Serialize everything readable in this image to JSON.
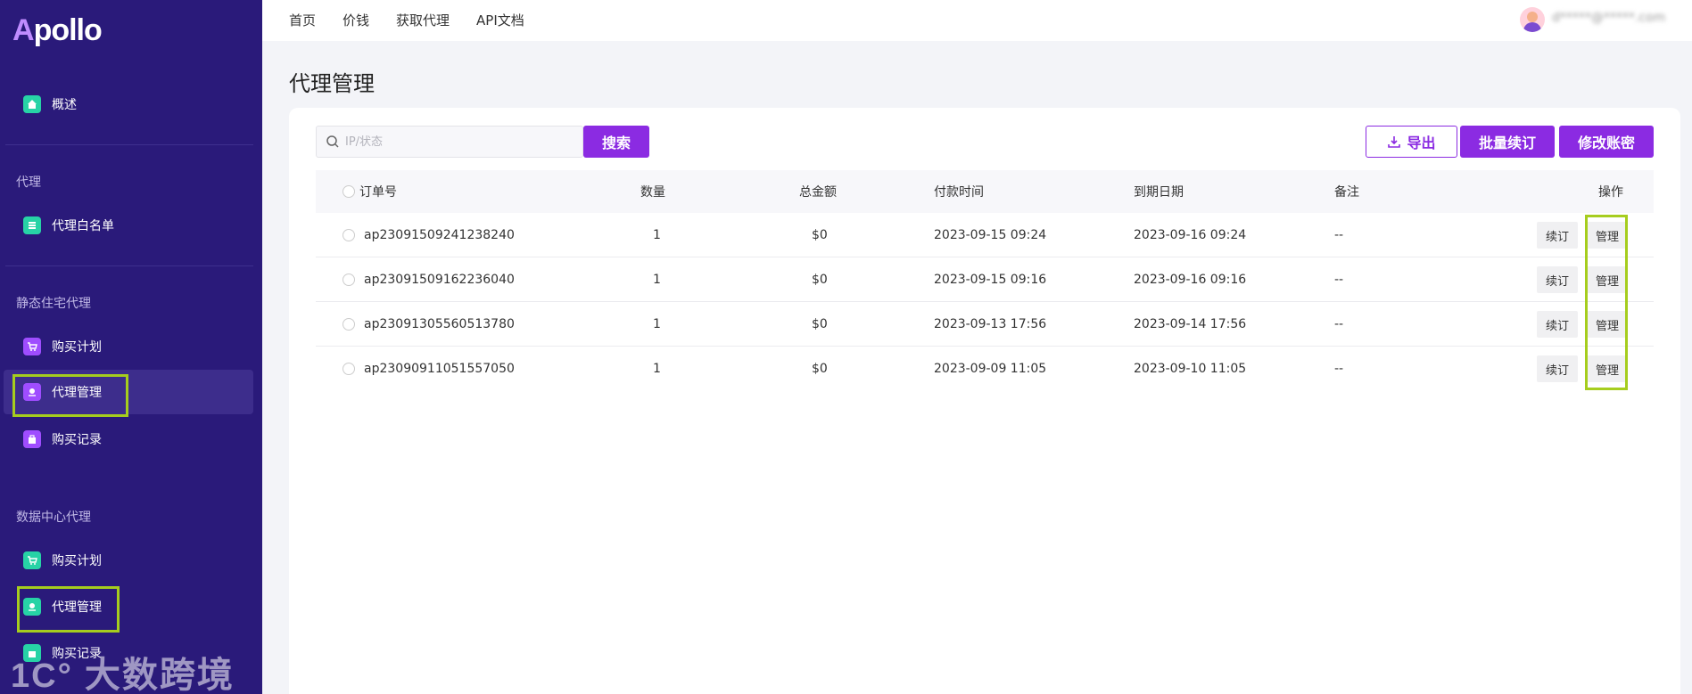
{
  "brand": {
    "logo_text": "Apollo"
  },
  "sidebar": {
    "overview": "概述",
    "section_proxy": "代理",
    "whitelist": "代理白名单",
    "section_static": "静态住宅代理",
    "static_buy_plan": "购买计划",
    "static_proxy_manage": "代理管理",
    "static_buy_record": "购买记录",
    "section_datacenter": "数据中心代理",
    "dc_buy_plan": "购买计划",
    "dc_proxy_manage": "代理管理",
    "dc_buy_record": "购买记录"
  },
  "topnav": {
    "home": "首页",
    "price": "价钱",
    "get_proxy": "获取代理",
    "api_docs": "API文档",
    "user_email": "d*****@*****.com"
  },
  "page": {
    "title": "代理管理"
  },
  "toolbar": {
    "search_placeholder": "IP/状态",
    "search_label": "搜索",
    "export_label": "导出",
    "batch_renew_label": "批量续订",
    "modify_account_label": "修改账密"
  },
  "table": {
    "headers": {
      "order_no": "订单号",
      "quantity": "数量",
      "total": "总金额",
      "paid_time": "付款时间",
      "expire_date": "到期日期",
      "note": "备注",
      "actions": "操作"
    },
    "rows": [
      {
        "order_no": "ap23091509241238240",
        "quantity": "1",
        "total": "$0",
        "paid_time": "2023-09-15 09:24",
        "expire_date": "2023-09-16 09:24",
        "note": "--",
        "renew": "续订",
        "manage": "管理"
      },
      {
        "order_no": "ap23091509162236040",
        "quantity": "1",
        "total": "$0",
        "paid_time": "2023-09-15 09:16",
        "expire_date": "2023-09-16 09:16",
        "note": "--",
        "renew": "续订",
        "manage": "管理"
      },
      {
        "order_no": "ap23091305560513780",
        "quantity": "1",
        "total": "$0",
        "paid_time": "2023-09-13 17:56",
        "expire_date": "2023-09-14 17:56",
        "note": "--",
        "renew": "续订",
        "manage": "管理"
      },
      {
        "order_no": "ap23090911051557050",
        "quantity": "1",
        "total": "$0",
        "paid_time": "2023-09-09 11:05",
        "expire_date": "2023-09-10 11:05",
        "note": "--",
        "renew": "续订",
        "manage": "管理"
      }
    ]
  },
  "watermark": {
    "text": "大数跨境"
  },
  "colors": {
    "sidebar_bg": "#2a1a7a",
    "accent": "#8b2be2",
    "highlight": "#a6cd1e"
  }
}
